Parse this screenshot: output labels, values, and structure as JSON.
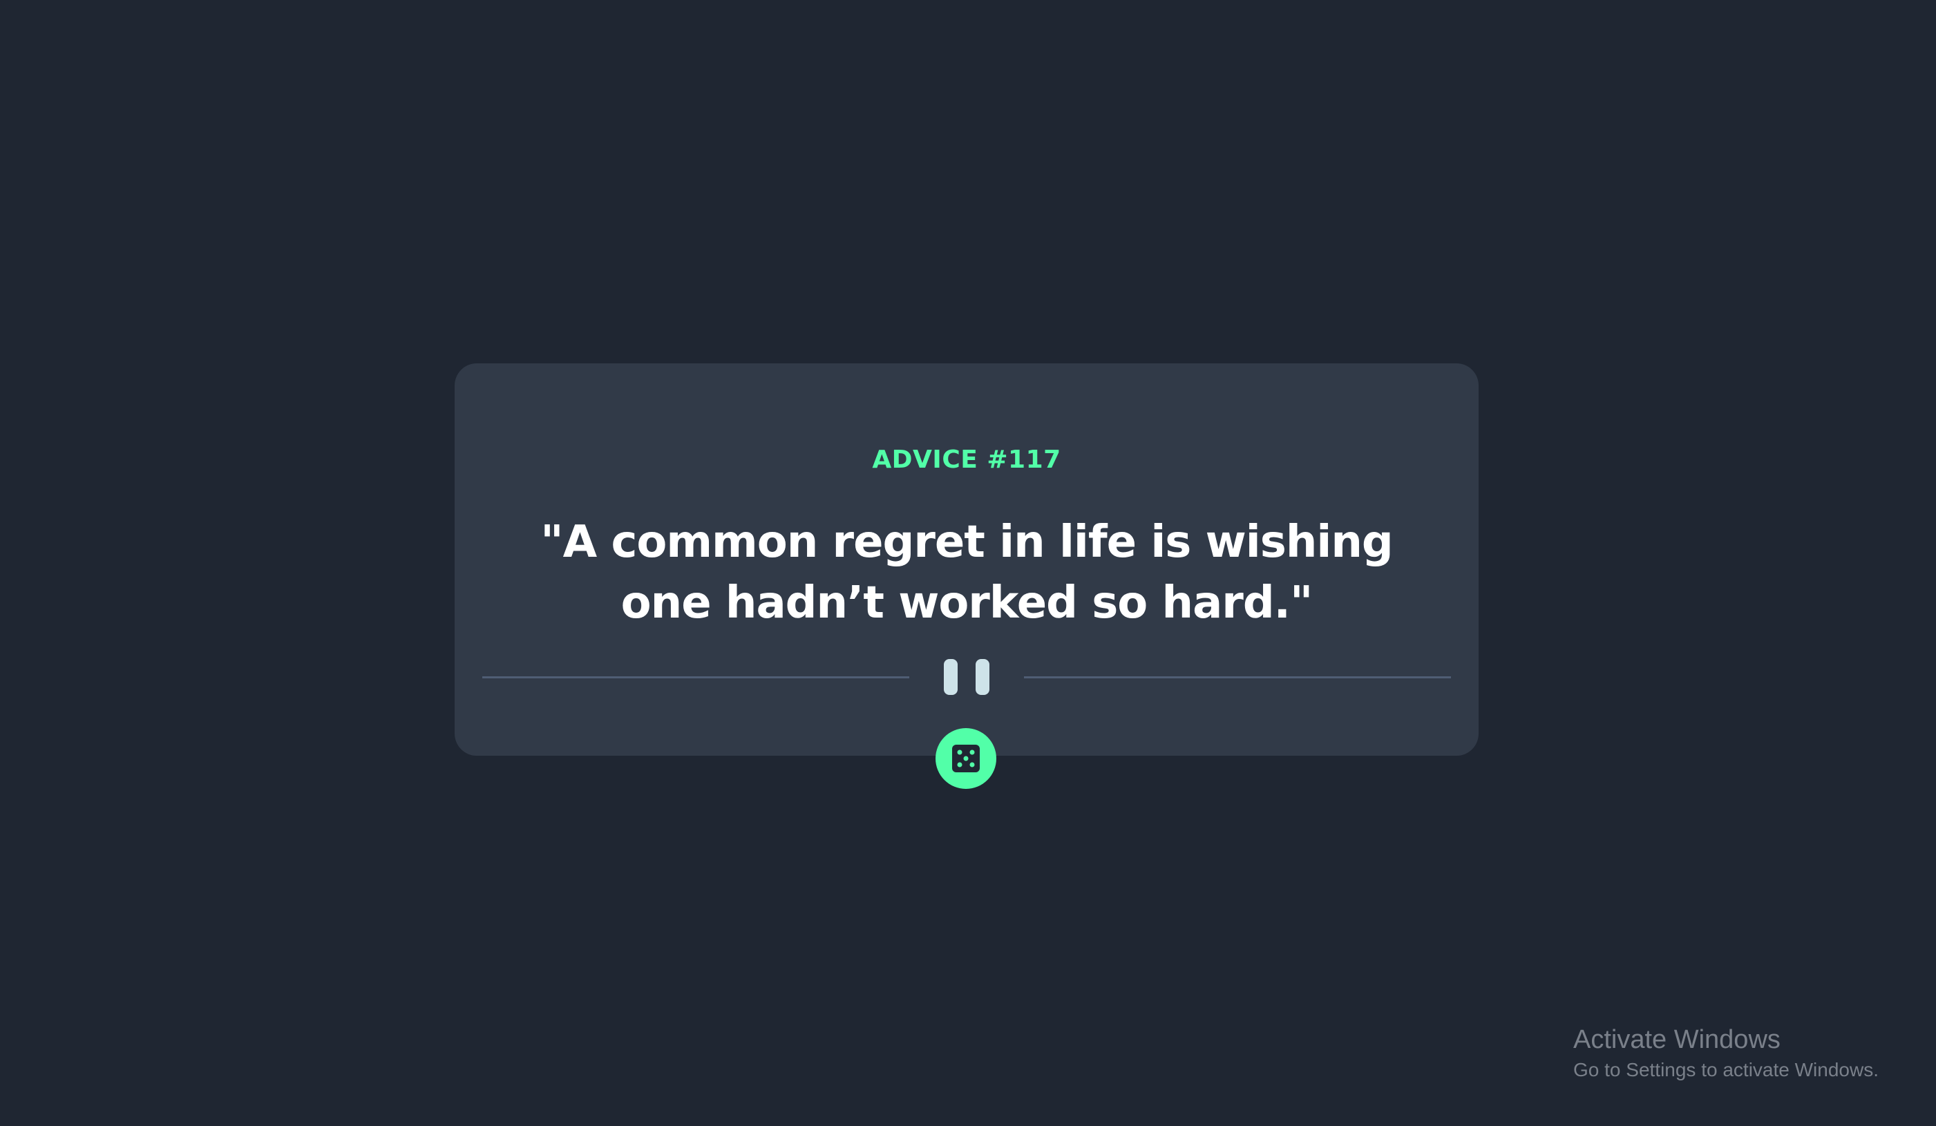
{
  "advice": {
    "label": "ADVICE #117",
    "quote": "\"A common regret in life is wishing one hadn’t worked so hard.\""
  },
  "controls": {
    "dice_icon": "dice-icon",
    "divider_icon": "pause-icon"
  },
  "colors": {
    "background": "#1f2632",
    "card": "#313a48",
    "accent": "#52ffa8",
    "text": "#ffffff",
    "divider": "#4f5d74",
    "pause": "#cee3e9"
  },
  "system_watermark": {
    "title": "Activate Windows",
    "subtitle": "Go to Settings to activate Windows."
  }
}
